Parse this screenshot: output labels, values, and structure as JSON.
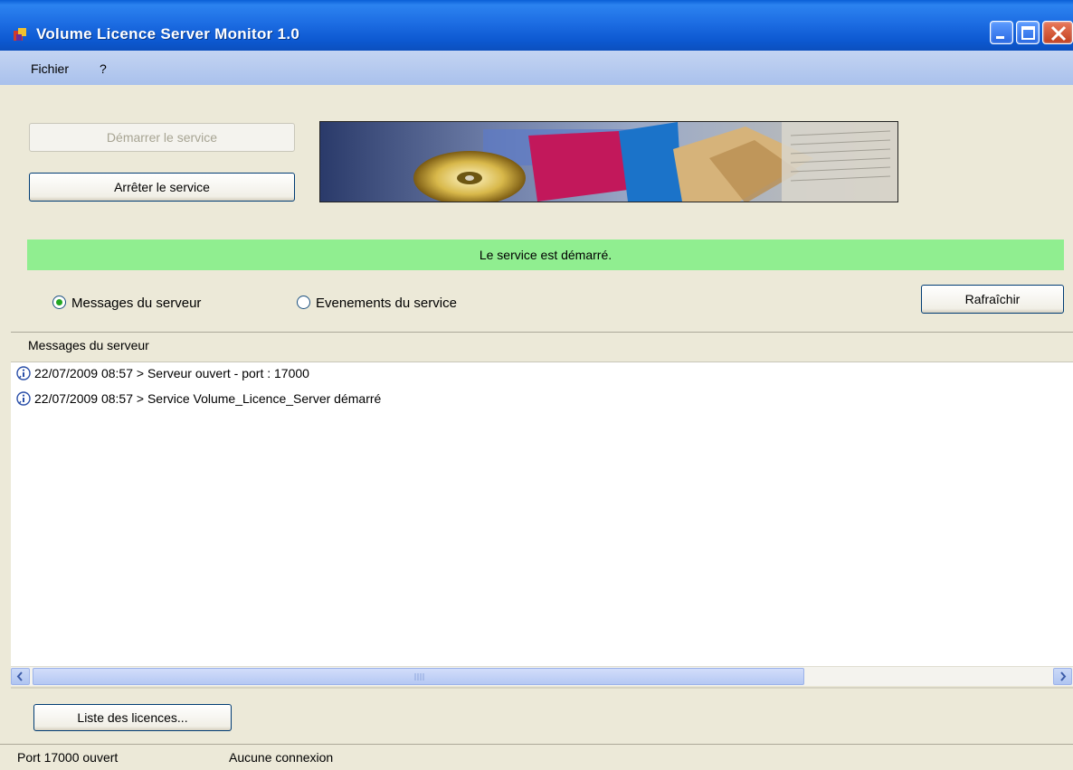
{
  "window": {
    "title": "Volume Licence Server Monitor 1.0"
  },
  "menu": {
    "items": [
      {
        "label": "Fichier"
      },
      {
        "label": "?"
      }
    ]
  },
  "controls": {
    "start_label": "Démarrer le service",
    "stop_label": "Arrêter le service",
    "refresh_label": "Rafraîchir",
    "licenses_label": "Liste des licences..."
  },
  "status": {
    "message": "Le service est démarré.",
    "color": "#90ee90"
  },
  "view": {
    "options": [
      {
        "label": "Messages du serveur",
        "selected": true
      },
      {
        "label": "Evenements du service",
        "selected": false
      }
    ]
  },
  "log": {
    "header": "Messages du serveur",
    "rows": [
      {
        "icon": "info-icon",
        "text": "22/07/2009 08:57 > Serveur ouvert - port : 17000"
      },
      {
        "icon": "info-icon",
        "text": "22/07/2009 08:57 > Service Volume_Licence_Server démarré"
      }
    ]
  },
  "statusbar": {
    "port": "Port 17000 ouvert",
    "connection": "Aucune connexion"
  }
}
